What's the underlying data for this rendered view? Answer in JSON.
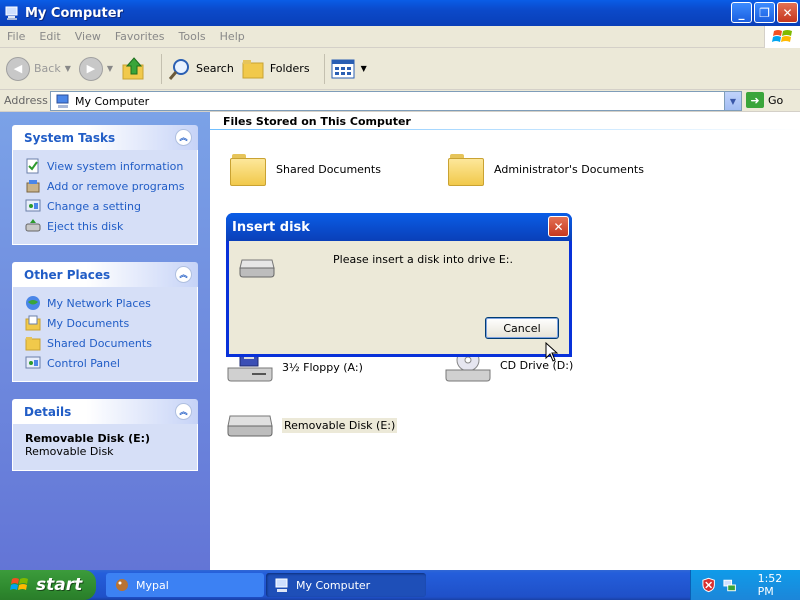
{
  "window": {
    "title": "My Computer",
    "buttons": [
      "_",
      "❐",
      "✕"
    ]
  },
  "menu": [
    "File",
    "Edit",
    "View",
    "Favorites",
    "Tools",
    "Help"
  ],
  "toolbar": {
    "back_label": "Back",
    "search_label": "Search",
    "folders_label": "Folders"
  },
  "address": {
    "label": "Address",
    "value": "My Computer",
    "go_label": "Go"
  },
  "taskpane": {
    "system_tasks": {
      "title": "System Tasks",
      "items": [
        "View system information",
        "Add or remove programs",
        "Change a setting",
        "Eject this disk"
      ]
    },
    "other_places": {
      "title": "Other Places",
      "items": [
        "My Network Places",
        "My Documents",
        "Shared Documents",
        "Control Panel"
      ]
    },
    "details": {
      "title": "Details",
      "name": "Removable Disk (E:)",
      "type": "Removable Disk"
    }
  },
  "content": {
    "section_files": "Files Stored on This Computer",
    "shared_documents": "Shared Documents",
    "admin_documents": "Administrator's Documents",
    "floppy": "3½ Floppy (A:)",
    "cd_drive": "CD Drive (D:)",
    "removable": "Removable Disk (E:)"
  },
  "dialog": {
    "title": "Insert disk",
    "message": "Please insert a disk into drive E:.",
    "cancel_label": "Cancel",
    "close_glyph": "✕"
  },
  "taskbar": {
    "start_label": "start",
    "tasks": [
      "Mypal",
      "My Computer"
    ],
    "clock": "1:52 PM"
  },
  "colors": {
    "xp_blue": "#0a5de6",
    "task_link": "#215dc6",
    "start_green": "#3c9b3c"
  }
}
